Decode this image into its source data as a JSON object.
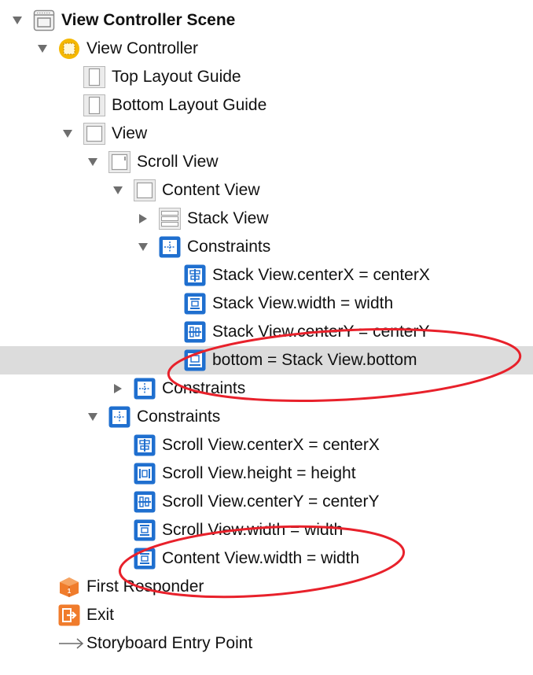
{
  "outline": {
    "items": [
      {
        "label": "View Controller Scene",
        "icon": "scene-icon",
        "disclosure": "expanded",
        "bold": true
      },
      {
        "label": "View Controller",
        "icon": "view-controller-icon",
        "disclosure": "expanded"
      },
      {
        "label": "Top Layout Guide",
        "icon": "layout-guide-icon",
        "disclosure": "none"
      },
      {
        "label": "Bottom Layout Guide",
        "icon": "layout-guide-icon",
        "disclosure": "none"
      },
      {
        "label": "View",
        "icon": "view-icon",
        "disclosure": "expanded"
      },
      {
        "label": "Scroll View",
        "icon": "scroll-view-icon",
        "disclosure": "expanded"
      },
      {
        "label": "Content View",
        "icon": "view-icon",
        "disclosure": "expanded"
      },
      {
        "label": "Stack View",
        "icon": "stack-view-icon",
        "disclosure": "collapsed"
      },
      {
        "label": "Constraints",
        "icon": "constraints-icon",
        "disclosure": "expanded"
      },
      {
        "label": "Stack View.centerX = centerX",
        "icon": "center-x-constraint-icon",
        "disclosure": "none"
      },
      {
        "label": "Stack View.width = width",
        "icon": "width-constraint-icon",
        "disclosure": "none"
      },
      {
        "label": "Stack View.centerY = centerY",
        "icon": "center-y-constraint-icon",
        "disclosure": "none"
      },
      {
        "label": "bottom = Stack View.bottom",
        "icon": "bottom-constraint-icon",
        "disclosure": "none",
        "selected": true
      },
      {
        "label": "Constraints",
        "icon": "constraints-icon",
        "disclosure": "collapsed"
      },
      {
        "label": "Constraints",
        "icon": "constraints-icon",
        "disclosure": "expanded"
      },
      {
        "label": "Scroll View.centerX = centerX",
        "icon": "center-x-constraint-icon",
        "disclosure": "none"
      },
      {
        "label": "Scroll View.height = height",
        "icon": "height-constraint-icon",
        "disclosure": "none"
      },
      {
        "label": "Scroll View.centerY = centerY",
        "icon": "center-y-constraint-icon",
        "disclosure": "none"
      },
      {
        "label": "Scroll View.width = width",
        "icon": "width-constraint-icon",
        "disclosure": "none"
      },
      {
        "label": "Content View.width = width",
        "icon": "width-constraint-icon",
        "disclosure": "none"
      },
      {
        "label": "First Responder",
        "icon": "first-responder-icon",
        "disclosure": "none"
      },
      {
        "label": "Exit",
        "icon": "exit-icon",
        "disclosure": "none"
      },
      {
        "label": "Storyboard Entry Point",
        "icon": "entry-point-arrow-icon",
        "disclosure": "none"
      }
    ]
  },
  "colors": {
    "selection": "#dcdcdc",
    "constraint_blue": "#1f6fcf",
    "annotation_red": "#e8212b",
    "view_controller_yellow": "#f5b800",
    "orange": "#f07c2c"
  }
}
